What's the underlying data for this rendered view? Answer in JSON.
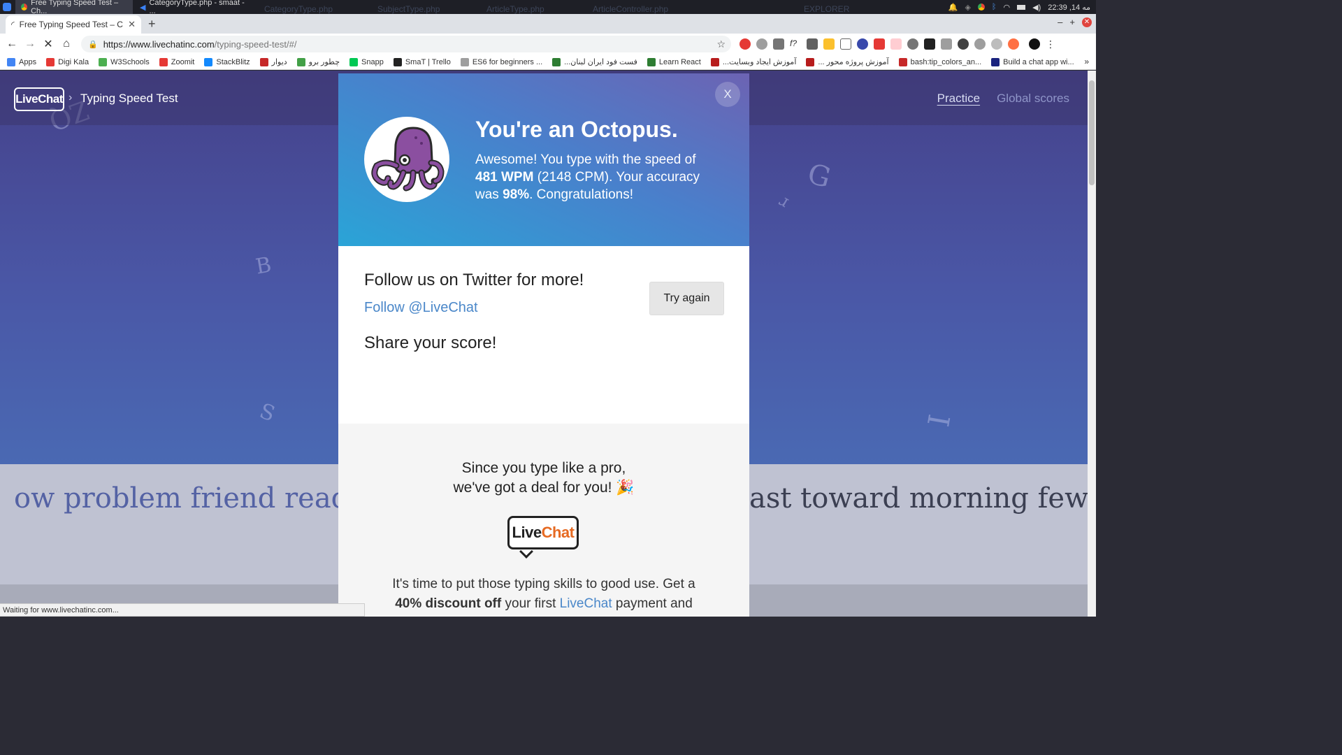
{
  "os_bar": {
    "tabs": [
      {
        "label": "Free Typing Speed Test – Ch..."
      },
      {
        "label": "CategoryType.php - smaat - ..."
      }
    ],
    "ghost_labels": [
      "CategoryType.php",
      "SubjectType.php",
      "ArticleType.php",
      "ArticleController.php",
      "EXPLORER"
    ],
    "clock": "22:39 ,14 مه"
  },
  "browser": {
    "tab_title": "Free Typing Speed Test – Check",
    "new_tab": "+",
    "url_host": "https://www.livechatinc.com",
    "url_path": "/typing-speed-test/#/",
    "bookmarks": [
      {
        "label": "Apps",
        "color": "#4285f4"
      },
      {
        "label": "Digi Kala",
        "color": "#e53935"
      },
      {
        "label": "W3Schools",
        "color": "#4caf50"
      },
      {
        "label": "Zoomit",
        "color": "#e53935"
      },
      {
        "label": "StackBlitz",
        "color": "#1389fd"
      },
      {
        "label": "دیوار",
        "color": "#c62828"
      },
      {
        "label": "چطور برو",
        "color": "#43a047"
      },
      {
        "label": "Snapp",
        "color": "#00c853"
      },
      {
        "label": "SmaT | Trello",
        "color": "#222222"
      },
      {
        "label": "ES6 for beginners ...",
        "color": "#9e9e9e"
      },
      {
        "label": "...فست فود ایران لبنان",
        "color": "#2e7d32"
      },
      {
        "label": "Learn React",
        "color": "#2e7d32"
      },
      {
        "label": "...آموزش ایجاد وبسایت",
        "color": "#b71c1c"
      },
      {
        "label": "... آموزش پروژه محور",
        "color": "#b71c1c"
      },
      {
        "label": "bash:tip_colors_an...",
        "color": "#c62828"
      },
      {
        "label": "Build a chat app wi...",
        "color": "#1a237e"
      }
    ],
    "status_text": "Waiting for www.livechatinc.com..."
  },
  "site": {
    "logo": "LiveChat",
    "title": "Typing Speed Test",
    "nav": {
      "practice": "Practice",
      "global": "Global scores"
    },
    "floating_letters": [
      "ZQ",
      "G",
      "B",
      "S",
      "I"
    ],
    "words_left": "ow problem friend ready",
    "words_right": "ast toward morning few if"
  },
  "modal": {
    "close": "X",
    "animal": "octopus",
    "title": "You're an Octopus.",
    "result_intro": "Awesome! You type with the speed of",
    "wpm": "481 WPM",
    "cpm": "(2148 CPM). Your accuracy",
    "was": "was",
    "accuracy": "98%",
    "congrats": ". Congratulations!",
    "follow_title": "Follow us on Twitter for more!",
    "follow_link": "Follow @LiveChat",
    "share_title": "Share your score!",
    "try_again": "Try again",
    "deal_line1": "Since you type like a pro,",
    "deal_line2": "we've got a deal for you! 🎉",
    "deal_logo_live": "Live",
    "deal_logo_chat": "Chat",
    "deal_text1": "It's time to put those typing skills to good use. Get a",
    "deal_discount": "40% discount off",
    "deal_text2": "your first",
    "deal_link": "LiveChat",
    "deal_text3": "payment and"
  },
  "colors": {
    "hero": "#4a57a6",
    "accent_blue": "#4a87c9",
    "octopus": "#8b4fa0"
  }
}
